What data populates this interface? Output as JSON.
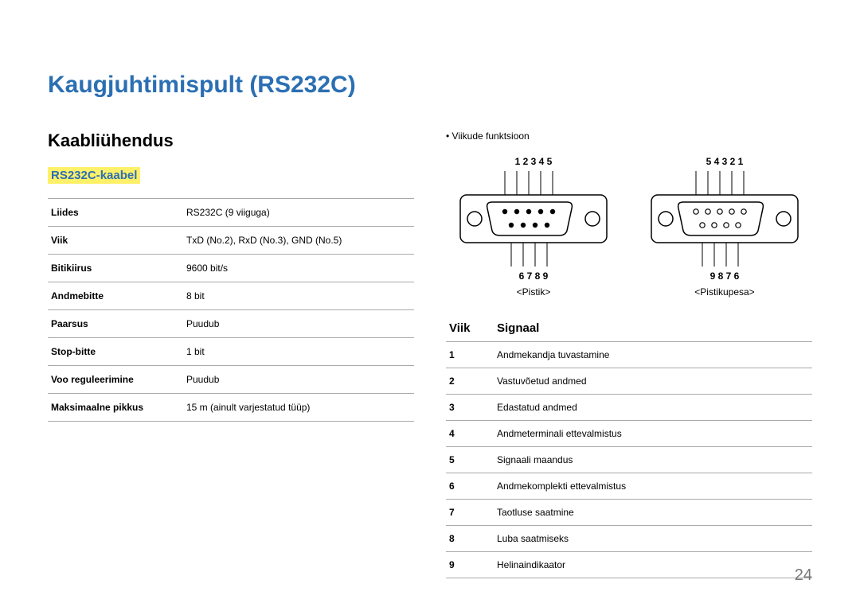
{
  "title": "Kaugjuhtimispult (RS232C)",
  "subtitle": "Kaabliühendus",
  "cable_heading": "RS232C-kaabel",
  "spec": [
    {
      "label": "Liides",
      "value": "RS232C (9 viiguga)"
    },
    {
      "label": "Viik",
      "value": "TxD (No.2), RxD (No.3), GND (No.5)"
    },
    {
      "label": "Bitikiirus",
      "value": "9600 bit/s"
    },
    {
      "label": "Andmebitte",
      "value": "8 bit"
    },
    {
      "label": "Paarsus",
      "value": "Puudub"
    },
    {
      "label": "Stop-bitte",
      "value": "1 bit"
    },
    {
      "label": "Voo reguleerimine",
      "value": "Puudub"
    },
    {
      "label": "Maksimaalne pikkus",
      "value": "15 m (ainult varjestatud tüüp)"
    }
  ],
  "pin_function_label": "Viikude funktsioon",
  "connector": {
    "top_nums_left": "1   2   3   4   5",
    "bot_nums_left": "6    7    8    9",
    "top_nums_right": "5   4   3   2   1",
    "bot_nums_right": "9    8    7    6",
    "left_label": "<Pistik>",
    "right_label": "<Pistikupesa>"
  },
  "signal_head": {
    "pin": "Viik",
    "signal": "Signaal"
  },
  "signals": [
    {
      "pin": "1",
      "name": "Andmekandja tuvastamine"
    },
    {
      "pin": "2",
      "name": "Vastuvõetud andmed"
    },
    {
      "pin": "3",
      "name": "Edastatud andmed"
    },
    {
      "pin": "4",
      "name": "Andmeterminali ettevalmistus"
    },
    {
      "pin": "5",
      "name": "Signaali maandus"
    },
    {
      "pin": "6",
      "name": "Andmekomplekti ettevalmistus"
    },
    {
      "pin": "7",
      "name": "Taotluse saatmine"
    },
    {
      "pin": "8",
      "name": "Luba saatmiseks"
    },
    {
      "pin": "9",
      "name": "Helinaindikaator"
    }
  ],
  "page_number": "24"
}
